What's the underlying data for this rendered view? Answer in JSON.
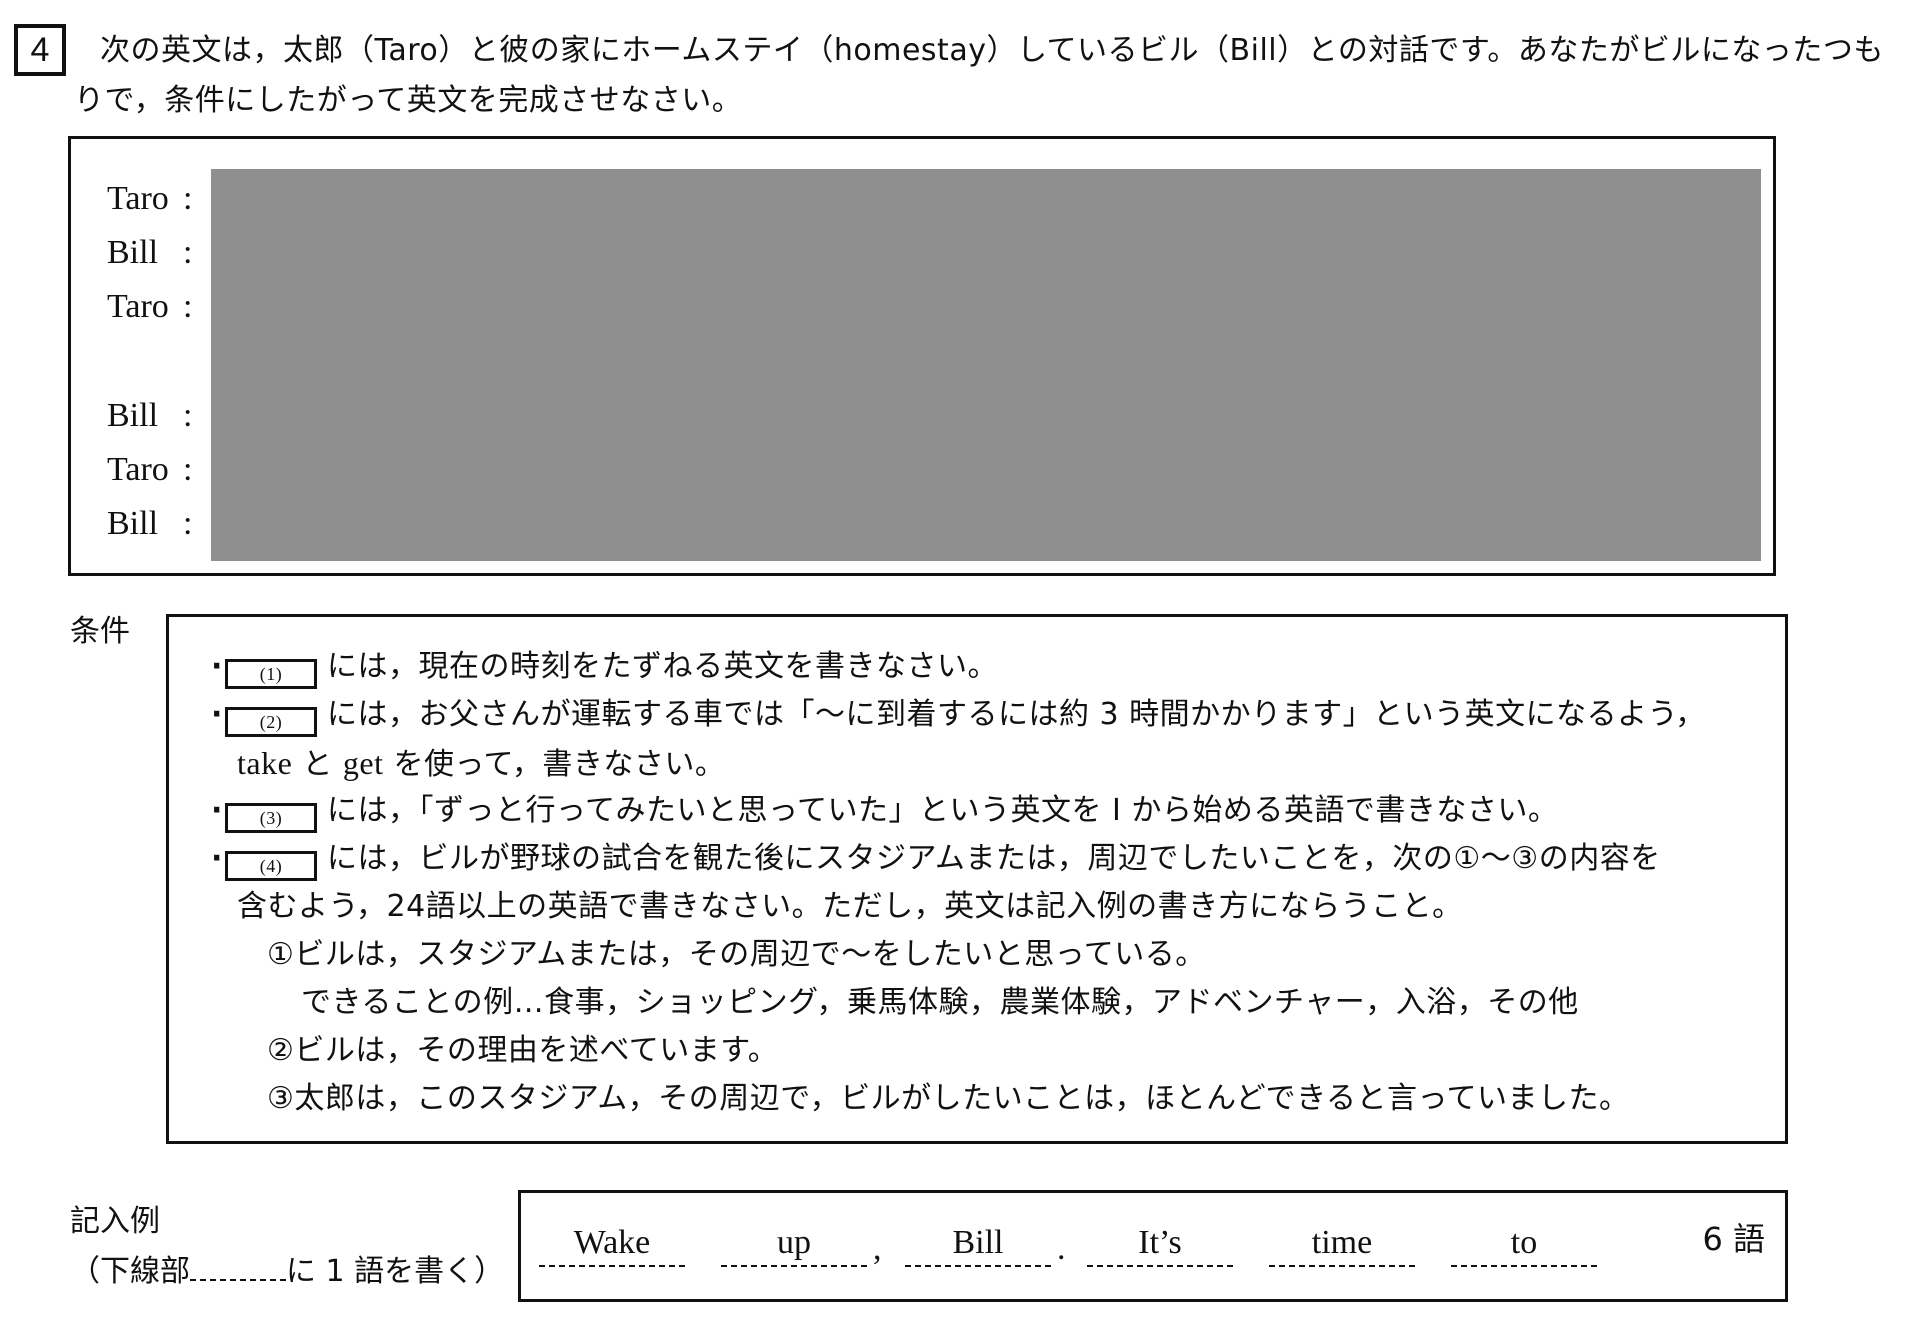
{
  "question": {
    "number": "4",
    "instruction_line1": "次の英文は，太郎（Taro）と彼の家にホームステイ（homestay）しているビル（Bill）との対話です。あなたがビルになったつも",
    "instruction_line2": "りで，条件にしたがって英文を完成させなさい。"
  },
  "dialogue": {
    "speakers": [
      {
        "name": "Taro",
        "colon": ":"
      },
      {
        "name": "Bill",
        "colon": ":"
      },
      {
        "name": "Taro",
        "colon": ":"
      },
      {
        "name": "Bill",
        "colon": ":"
      },
      {
        "name": "Taro",
        "colon": ":"
      },
      {
        "name": "Bill",
        "colon": ":"
      }
    ],
    "redacted": true,
    "redaction_color": "#8f8f8f"
  },
  "conditions": {
    "label": "条件",
    "items": [
      {
        "blank": "(1)",
        "text": "には，現在の時刻をたずねる英文を書きなさい。"
      },
      {
        "blank": "(2)",
        "text": "には，お父さんが運転する車では「～に到着するには約 3 時間かかります」という英文になるよう，",
        "continuation_en1": "take",
        "continuation_mid": " と ",
        "continuation_en2": "get",
        "continuation_tail": " を使って，書きなさい。"
      },
      {
        "blank": "(3)",
        "text": "には，「ずっと行ってみたいと思っていた」という英文を I から始める英語で書きなさい。"
      },
      {
        "blank": "(4)",
        "text": "には，ビルが野球の試合を観た後にスタジアムまたは，周辺でしたいことを，次の①～③の内容を",
        "continuation": "含むよう，24語以上の英語で書きなさい。ただし，英文は記入例の書き方にならうこと。"
      }
    ],
    "sub_points": [
      "①ビルは，スタジアムまたは，その周辺で～をしたいと思っている。",
      "できることの例…食事，ショッピング，乗馬体験，農業体験，アドベンチャー，入浴，その他",
      "②ビルは，その理由を述べています。",
      "③太郎は，このスタジアム，その周辺で，ビルがしたいことは，ほとんどできると言っていました。"
    ]
  },
  "example": {
    "label": "記入例",
    "note_prefix": "（下線部",
    "note_suffix": "に 1 語を書く）",
    "words": [
      "Wake",
      "up",
      "Bill",
      "It’s",
      "time",
      "to"
    ],
    "punctuation": [
      ",",
      "."
    ],
    "word_count": "6 語"
  }
}
